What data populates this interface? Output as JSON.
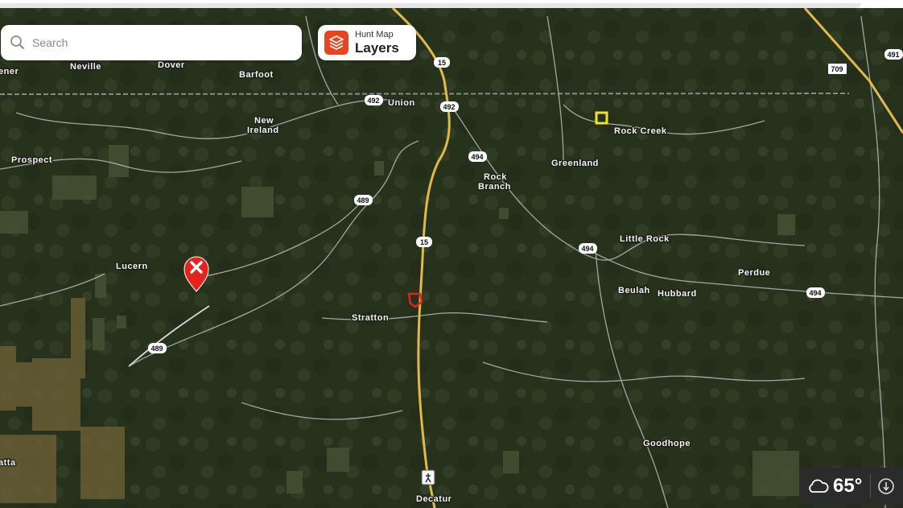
{
  "search": {
    "placeholder": "Search"
  },
  "layers_button": {
    "subtitle": "Hunt Map",
    "title": "Layers"
  },
  "weather": {
    "temperature": "65°",
    "icon": "cloud-icon"
  },
  "colors": {
    "accent": "#e8451e",
    "road_major": "#e3b84a",
    "road_minor": "#c9cfd2",
    "label": "#f2f2f2"
  },
  "map": {
    "places": [
      {
        "label": "ener"
      },
      {
        "label": "Neville"
      },
      {
        "label": "Dover"
      },
      {
        "label": "Barfoot"
      },
      {
        "label": "New"
      },
      {
        "label": "Ireland"
      },
      {
        "label": "Union"
      },
      {
        "label": "Rock Creek"
      },
      {
        "label": "Prospect"
      },
      {
        "label": "Rock"
      },
      {
        "label": "Branch"
      },
      {
        "label": "Greenland"
      },
      {
        "label": "Little Rock"
      },
      {
        "label": "Lucern"
      },
      {
        "label": "Perdue"
      },
      {
        "label": "Beulah"
      },
      {
        "label": "Hubbard"
      },
      {
        "label": "Stratton"
      },
      {
        "label": "Goodhope"
      },
      {
        "label": "atta"
      },
      {
        "label": "Decatur"
      }
    ],
    "shields": [
      {
        "label": "15"
      },
      {
        "label": "492"
      },
      {
        "label": "492"
      },
      {
        "label": "494"
      },
      {
        "label": "489"
      },
      {
        "label": "15"
      },
      {
        "label": "494"
      },
      {
        "label": "494"
      },
      {
        "label": "489"
      },
      {
        "label": "709"
      },
      {
        "label": "491"
      }
    ],
    "marker": {
      "icon": "close-icon"
    }
  }
}
